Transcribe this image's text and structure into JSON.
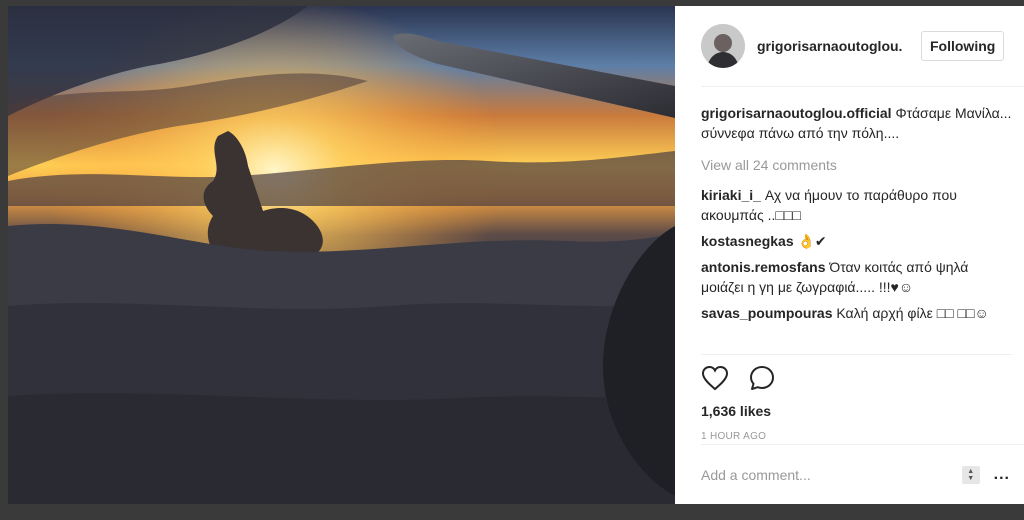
{
  "post": {
    "username": "grigorisarnaoutoglou.",
    "follow_label": "Following",
    "caption_user": "grigorisarnaoutoglou.official",
    "caption_text": " Φτάσαμε Μανίλα... σύννεφα πάνω από την πόλη....",
    "view_all": "View all 24 comments",
    "comments": [
      {
        "user": "kiriaki_i_",
        "text": " Αχ να ήμουν το παράθυρο που ακουμπάς ..□□□"
      },
      {
        "user": "kostasnegkas",
        "text": " 👌✔"
      },
      {
        "user": "antonis.remosfans",
        "text": " Όταν κοιτάς από ψηλά μοιάζει η γη με ζωγραφιά..... !!!♥☺"
      },
      {
        "user": "savas_poumpouras",
        "text": " Καλή αρχή φίλε □□ □□☺"
      }
    ],
    "likes": "1,636 likes",
    "time": "1 HOUR AGO",
    "comment_placeholder": "Add a comment...",
    "more_label": "..."
  },
  "icons": {
    "like": "heart-icon",
    "comment": "comment-bubble-icon",
    "more": "more-options-icon"
  }
}
